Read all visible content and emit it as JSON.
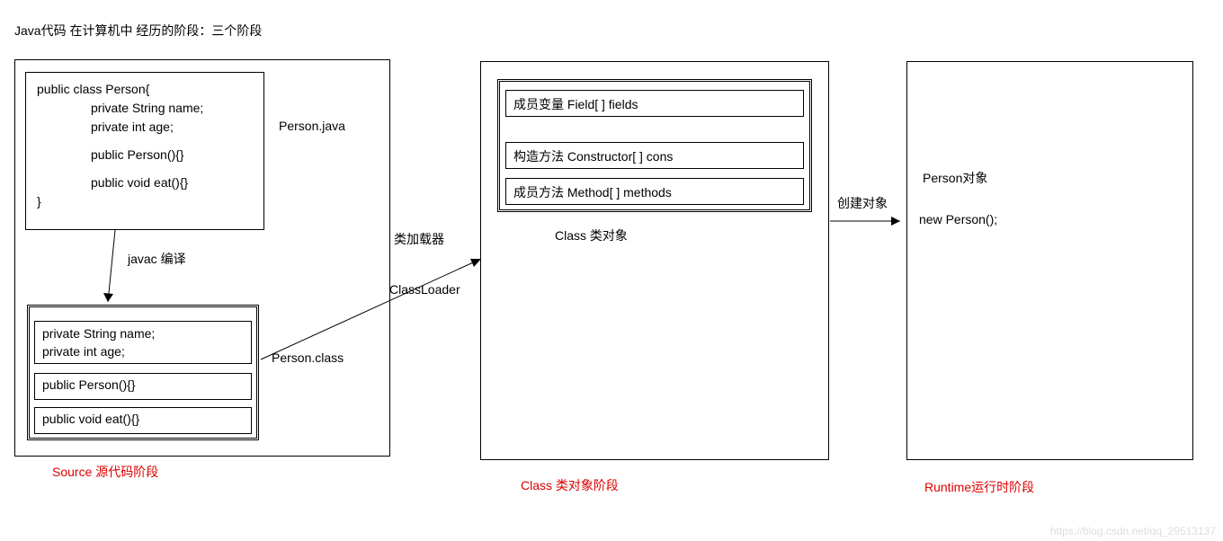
{
  "title": "Java代码 在计算机中 经历的阶段：三个阶段",
  "stage1": {
    "java_source": {
      "l1": "public class Person{",
      "l2": "private String name;",
      "l3": "private int age;",
      "l4": "public Person(){}",
      "l5": "public void eat(){}",
      "l6": "}"
    },
    "java_file_label": "Person.java",
    "compile_label": "javac 编译",
    "class_file": {
      "field1": "private String name;",
      "field2": "private int age;",
      "ctor": "public Person(){}",
      "method": "public void eat(){}"
    },
    "class_file_label": "Person.class",
    "stage_label": "Source 源代码阶段"
  },
  "transition1": {
    "loader_label_cn": "类加载器",
    "loader_label_en": "ClassLoader"
  },
  "stage2": {
    "fields": "成员变量  Field[ ] fields",
    "cons": "构造方法  Constructor[ ] cons",
    "methods": "成员方法 Method[ ] methods",
    "class_obj_label": "Class 类对象",
    "stage_label": "Class 类对象阶段"
  },
  "transition2": {
    "create_obj_label": "创建对象"
  },
  "stage3": {
    "obj_label": "Person对象",
    "instantiation": "new Person();",
    "stage_label": "Runtime运行时阶段"
  },
  "watermark": "https://blog.csdn.net/qq_29513137"
}
